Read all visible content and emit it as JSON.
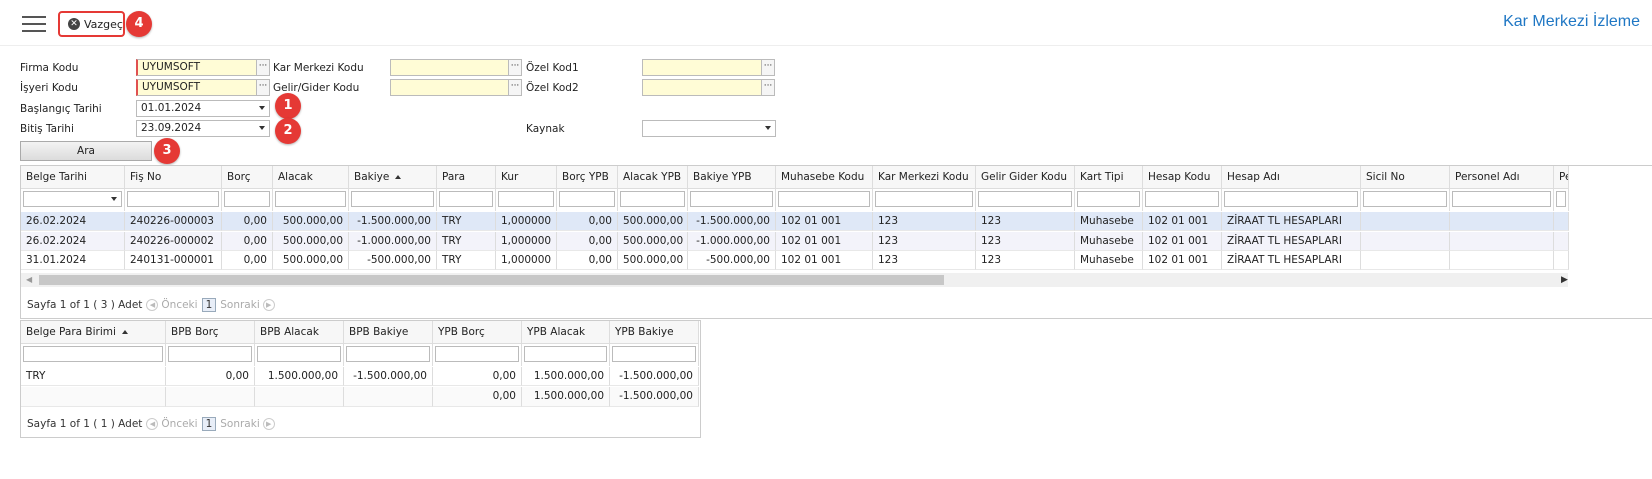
{
  "header": {
    "cancel_label": "Vazgeç",
    "page_title": "Kar Merkezi İzleme"
  },
  "badges": [
    "1",
    "2",
    "3",
    "4"
  ],
  "form": {
    "firma_kodu_label": "Firma Kodu",
    "firma_kodu_value": "UYUMSOFT",
    "isyeri_kodu_label": "İşyeri Kodu",
    "isyeri_kodu_value": "UYUMSOFT",
    "baslangic_label": "Başlangıç Tarihi",
    "baslangic_value": "01.01.2024",
    "bitis_label": "Bitiş Tarihi",
    "bitis_value": "23.09.2024",
    "kar_merkezi_label": "Kar Merkezi Kodu",
    "kar_merkezi_value": "",
    "gelir_gider_label": "Gelir/Gider Kodu",
    "gelir_gider_value": "",
    "ozel_kod1_label": "Özel Kod1",
    "ozel_kod1_value": "",
    "ozel_kod2_label": "Özel Kod2",
    "ozel_kod2_value": "",
    "kaynak_label": "Kaynak",
    "kaynak_value": "",
    "dots": "···",
    "search_label": "Ara"
  },
  "main_grid": {
    "columns": [
      "Belge Tarihi",
      "Fiş No",
      "Borç",
      "Alacak",
      "Bakiye",
      "Para",
      "Kur",
      "Borç YPB",
      "Alacak YPB",
      "Bakiye YPB",
      "Muhasebe Kodu",
      "Kar Merkezi Kodu",
      "Gelir Gider Kodu",
      "Kart Tipi",
      "Hesap Kodu",
      "Hesap Adı",
      "Sicil No",
      "Personel Adı",
      "Pe"
    ],
    "rows": [
      [
        "26.02.2024",
        "240226-000003",
        "0,00",
        "500.000,00",
        "-1.500.000,00",
        "TRY",
        "1,000000",
        "0,00",
        "500.000,00",
        "-1.500.000,00",
        "102 01 001",
        "123",
        "123",
        "Muhasebe",
        "102 01 001",
        "ZİRAAT TL HESAPLARI",
        "",
        "",
        ""
      ],
      [
        "26.02.2024",
        "240226-000002",
        "0,00",
        "500.000,00",
        "-1.000.000,00",
        "TRY",
        "1,000000",
        "0,00",
        "500.000,00",
        "-1.000.000,00",
        "102 01 001",
        "123",
        "123",
        "Muhasebe",
        "102 01 001",
        "ZİRAAT TL HESAPLARI",
        "",
        "",
        ""
      ],
      [
        "31.01.2024",
        "240131-000001",
        "0,00",
        "500.000,00",
        "-500.000,00",
        "TRY",
        "1,000000",
        "0,00",
        "500.000,00",
        "-500.000,00",
        "102 01 001",
        "123",
        "123",
        "Muhasebe",
        "102 01 001",
        "ZİRAAT TL HESAPLARI",
        "",
        "",
        ""
      ]
    ],
    "pager": {
      "summary": "Sayfa 1 of 1 ( 3 ) Adet",
      "prev": "Önceki",
      "page": "1",
      "next": "Sonraki"
    }
  },
  "summary_grid": {
    "columns": [
      "Belge Para Birimi",
      "BPB Borç",
      "BPB Alacak",
      "BPB Bakiye",
      "YPB Borç",
      "YPB Alacak",
      "YPB Bakiye"
    ],
    "rows": [
      [
        "TRY",
        "0,00",
        "1.500.000,00",
        "-1.500.000,00",
        "0,00",
        "1.500.000,00",
        "-1.500.000,00"
      ]
    ],
    "totals": [
      "",
      "",
      "",
      "",
      "0,00",
      "1.500.000,00",
      "-1.500.000,00"
    ],
    "pager": {
      "summary": "Sayfa 1 of 1 ( 1 ) Adet",
      "prev": "Önceki",
      "page": "1",
      "next": "Sonraki"
    }
  },
  "colors": {
    "accent": "#1f77c4",
    "badge": "#e53935",
    "selected_row": "#dfe8f7",
    "required_field": "#fffcd6"
  }
}
